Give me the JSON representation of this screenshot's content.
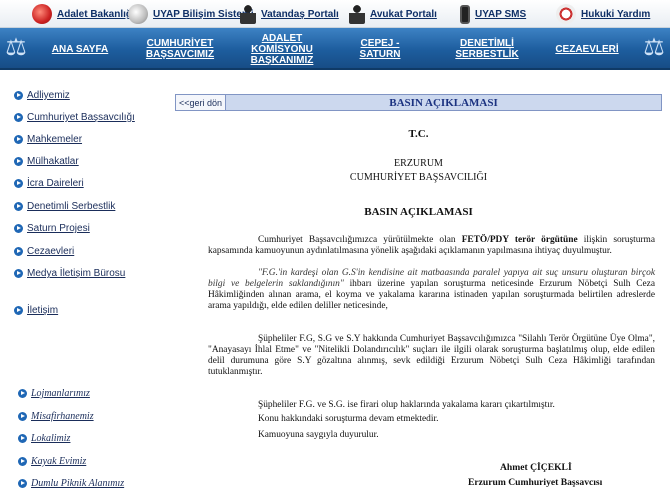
{
  "top_links": [
    {
      "label": "Adalet Bakanlığı",
      "icon": "emblem-icon"
    },
    {
      "label": "UYAP Bilişim Sistemi",
      "icon": "uyap-icon"
    },
    {
      "label": "Vatandaş Portalı",
      "icon": "people-icon"
    },
    {
      "label": "Avukat Portalı",
      "icon": "lawyer-icon"
    },
    {
      "label": "UYAP SMS",
      "icon": "phone-icon"
    },
    {
      "label": "Hukuki Yardım",
      "icon": "legal-aid-icon"
    }
  ],
  "nav": [
    {
      "line1": "ANA SAYFA",
      "line2": ""
    },
    {
      "line1": "CUMHURİYET",
      "line2": "BAŞSAVCIMIZ"
    },
    {
      "line1": "ADALET KOMİSYONU",
      "line2": "BAŞKANIMIZ"
    },
    {
      "line1": "CEPEJ - SATURN",
      "line2": ""
    },
    {
      "line1": "DENETİMLİ SERBESTLİK",
      "line2": ""
    },
    {
      "line1": "CEZAEVLERİ",
      "line2": ""
    }
  ],
  "sidebar": {
    "items": [
      "Adliyemiz",
      "Cumhuriyet Başsavcılığı",
      "Mahkemeler",
      "Mülhakatlar",
      "İcra Daireleri",
      "Denetimli Serbestlik",
      "Saturn Projesi",
      "Cezaevleri",
      "Medya İletişim Bürosu"
    ],
    "contact": "İletişim",
    "footer_items": [
      "Lojmanlarımız",
      "Misafirhanemiz",
      "Lokalimiz",
      "Kayak Evimiz",
      "Dumlu Piknik Alanımız"
    ]
  },
  "main": {
    "back_label": "<<geri dön",
    "header_title": "BASIN AÇIKLAMASI",
    "tc": "T.C.",
    "org_line1": "ERZURUM",
    "org_line2": "CUMHURİYET BAŞSAVCILIĞI",
    "doc_title": "BASIN AÇIKLAMASI",
    "p1_a": "Cumhuriyet Başsavcılığımızca yürütülmekte olan ",
    "p1_b": "FETÖ/PDY terör örgütüne",
    "p1_c": " ilişkin soruşturma kapsamında kamuoyunun aydınlatılmasına yönelik aşağıdaki açıklamanın yapılmasına ihtiyaç duyulmuştur.",
    "p2_a": "\"F.G.'in kardeşi olan G.S'in kendisine ait matbaasında paralel yapıya ait suç unsuru oluşturan birçok bilgi ve belgelerin saklandığının\"",
    "p2_b": " ihbarı üzerine yapılan soruşturma neticesinde Erzurum Nöbetçi Sulh Ceza Hâkimliğinden alınan arama, el koyma ve yakalama kararına istinaden yapılan soruşturmada belirtilen adreslerde arama yapıldığı, elde edilen deliller neticesinde,",
    "p3": "Şüpheliler F.G, S.G ve S.Y hakkında Cumhuriyet Başsavcılığımızca \"Silahlı Terör Örgütüne Üye Olma\", \"Anayasayı İhlal Etme\" ve \"Nitelikli Dolandırıcılık\" suçları ile ilgili olarak soruşturma başlatılmış olup, elde edilen delil durumuna göre S.Y gözaltına alınmış, sevk edildiği Erzurum Nöbetçi Sulh Ceza Hâkimliği tarafından tutuklanmıştır.",
    "p4": "Şüpheliler F.G. ve S.G. ise firari olup haklarında yakalama kararı çıkartılmıştır.",
    "p5": "Konu hakkındaki soruşturma devam etmektedir.",
    "p6": "Kamuoyuna saygıyla duyurulur.",
    "sig_name": "Ahmet ÇİÇEKLİ",
    "sig_title": "Erzurum Cumhuriyet Başsavcısı"
  }
}
